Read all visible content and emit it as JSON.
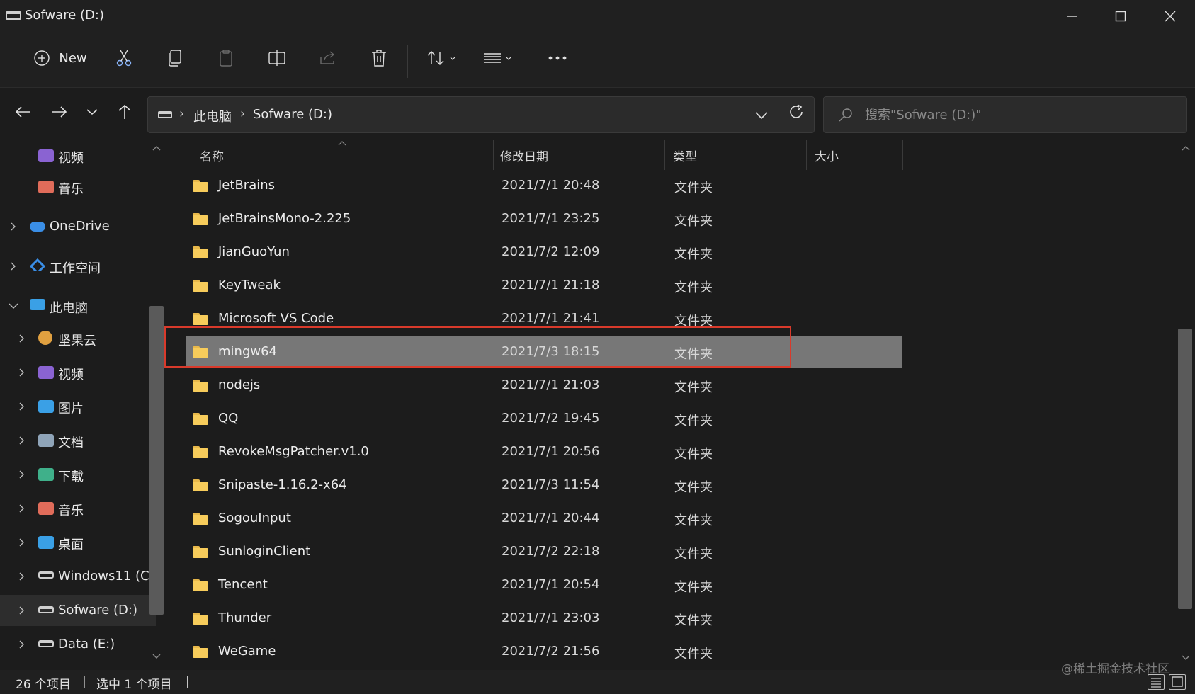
{
  "window": {
    "title": "Sofware (D:)"
  },
  "toolbar": {
    "new_label": "New"
  },
  "address": {
    "crumbs": [
      "此电脑",
      "Sofware (D:)"
    ]
  },
  "search": {
    "placeholder": "搜索\"Sofware (D:)\""
  },
  "sidebar": {
    "items": [
      {
        "label": "视频",
        "icon": "videos-folder-icon",
        "color": "#8a63d2"
      },
      {
        "label": "音乐",
        "icon": "music-folder-icon",
        "color": "#e06c5a"
      },
      {
        "label": "OneDrive",
        "icon": "cloud-icon",
        "color": "#3a8ee6"
      },
      {
        "label": "工作空间",
        "icon": "workspace-icon",
        "color": "#3a8ee6"
      },
      {
        "label": "此电脑",
        "icon": "computer-icon",
        "color": "#3aa0e6"
      },
      {
        "label": "坚果云",
        "icon": "nutstore-icon",
        "color": "#e0a040"
      },
      {
        "label": "视频",
        "icon": "videos-folder-icon",
        "color": "#8a63d2"
      },
      {
        "label": "图片",
        "icon": "pictures-folder-icon",
        "color": "#3aa0e6"
      },
      {
        "label": "文档",
        "icon": "documents-folder-icon",
        "color": "#8fa4b8"
      },
      {
        "label": "下载",
        "icon": "downloads-folder-icon",
        "color": "#3fb08a"
      },
      {
        "label": "音乐",
        "icon": "music-folder-icon",
        "color": "#e06c5a"
      },
      {
        "label": "桌面",
        "icon": "desktop-folder-icon",
        "color": "#3aa0e6"
      },
      {
        "label": "Windows11 (C",
        "icon": "drive-c-icon",
        "color": "#cfcfcf"
      },
      {
        "label": "Sofware (D:)",
        "icon": "drive-icon",
        "color": "#cfcfcf"
      },
      {
        "label": "Data (E:)",
        "icon": "drive-icon",
        "color": "#cfcfcf"
      }
    ]
  },
  "columns": {
    "name": "名称",
    "date": "修改日期",
    "type": "类型",
    "size": "大小"
  },
  "files": [
    {
      "name": "JetBrains",
      "date": "2021/7/1 20:48",
      "type": "文件夹"
    },
    {
      "name": "JetBrainsMono-2.225",
      "date": "2021/7/1 23:25",
      "type": "文件夹"
    },
    {
      "name": "JianGuoYun",
      "date": "2021/7/2 12:09",
      "type": "文件夹"
    },
    {
      "name": "KeyTweak",
      "date": "2021/7/1 21:18",
      "type": "文件夹"
    },
    {
      "name": "Microsoft VS Code",
      "date": "2021/7/1 21:41",
      "type": "文件夹"
    },
    {
      "name": "mingw64",
      "date": "2021/7/3 18:15",
      "type": "文件夹"
    },
    {
      "name": "nodejs",
      "date": "2021/7/1 21:03",
      "type": "文件夹"
    },
    {
      "name": "QQ",
      "date": "2021/7/2 19:45",
      "type": "文件夹"
    },
    {
      "name": "RevokeMsgPatcher.v1.0",
      "date": "2021/7/1 20:56",
      "type": "文件夹"
    },
    {
      "name": "Snipaste-1.16.2-x64",
      "date": "2021/7/3 11:54",
      "type": "文件夹"
    },
    {
      "name": "SogouInput",
      "date": "2021/7/1 20:44",
      "type": "文件夹"
    },
    {
      "name": "SunloginClient",
      "date": "2021/7/2 22:18",
      "type": "文件夹"
    },
    {
      "name": "Tencent",
      "date": "2021/7/1 20:54",
      "type": "文件夹"
    },
    {
      "name": "Thunder",
      "date": "2021/7/1 23:03",
      "type": "文件夹"
    },
    {
      "name": "WeGame",
      "date": "2021/7/2 21:56",
      "type": "文件夹"
    }
  ],
  "status": {
    "count": "26 个项目",
    "selected": "选中 1 个项目",
    "sep": "|"
  },
  "watermark": "@稀土掘金技术社区",
  "colors": {
    "selection": "#777777",
    "highlight_box": "#d93a2b",
    "folder": "#f7cc5b"
  }
}
